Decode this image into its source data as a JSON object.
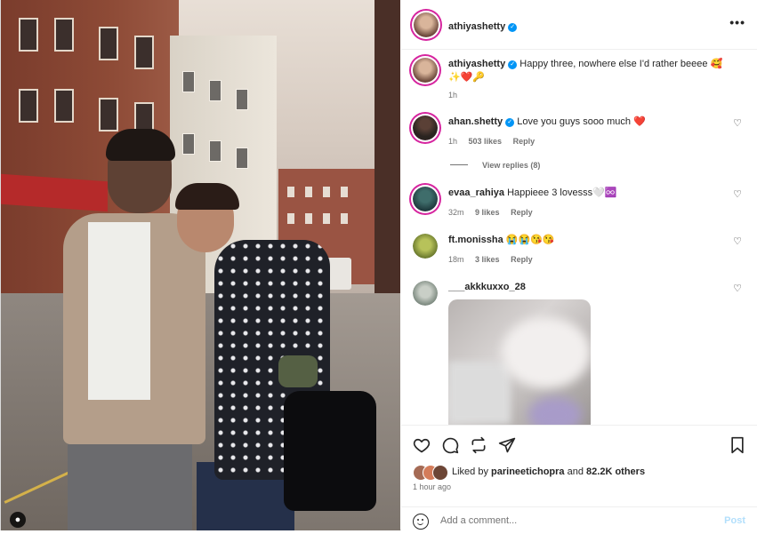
{
  "post": {
    "author": "athiyashetty",
    "caption_text": "Happy three, nowhere else I'd rather beeee 🥰",
    "caption_emojis": "✨❤️🔑",
    "caption_time": "1h"
  },
  "comments": [
    {
      "user": "ahan.shetty",
      "verified": true,
      "text": "Love you guys sooo much ❤️",
      "time": "1h",
      "likes": "503 likes",
      "reply": "Reply"
    },
    {
      "user": "evaa_rahiya",
      "verified": false,
      "text": "Happieee 3 lovesss🤍♾️",
      "time": "32m",
      "likes": "9 likes",
      "reply": "Reply"
    },
    {
      "user": "ft.monissha",
      "verified": false,
      "text": "😭😭😘😘",
      "time": "18m",
      "likes": "3 likes",
      "reply": "Reply"
    },
    {
      "user": "___akkkuxxo_28",
      "verified": false,
      "text": "",
      "time": "",
      "likes": "",
      "reply": ""
    }
  ],
  "view_replies": "View replies (8)",
  "liked_by": {
    "prefix": "Liked by ",
    "user": "parineetichopra",
    "and": " and ",
    "others": "82.2K others"
  },
  "time_ago": "1 hour ago",
  "add_comment": {
    "placeholder": "Add a comment...",
    "post_label": "Post"
  },
  "colors": {
    "verified": "#0095f6",
    "muted": "#737373",
    "post_disabled": "#b2dffc",
    "ring": "#d6249f"
  },
  "icons": {
    "more": "more-options-icon",
    "heart": "heart-icon",
    "comment": "comment-icon",
    "repost": "repost-icon",
    "share": "share-icon",
    "save": "save-icon",
    "emoji": "emoji-icon",
    "user_tag": "user-tag-icon"
  }
}
